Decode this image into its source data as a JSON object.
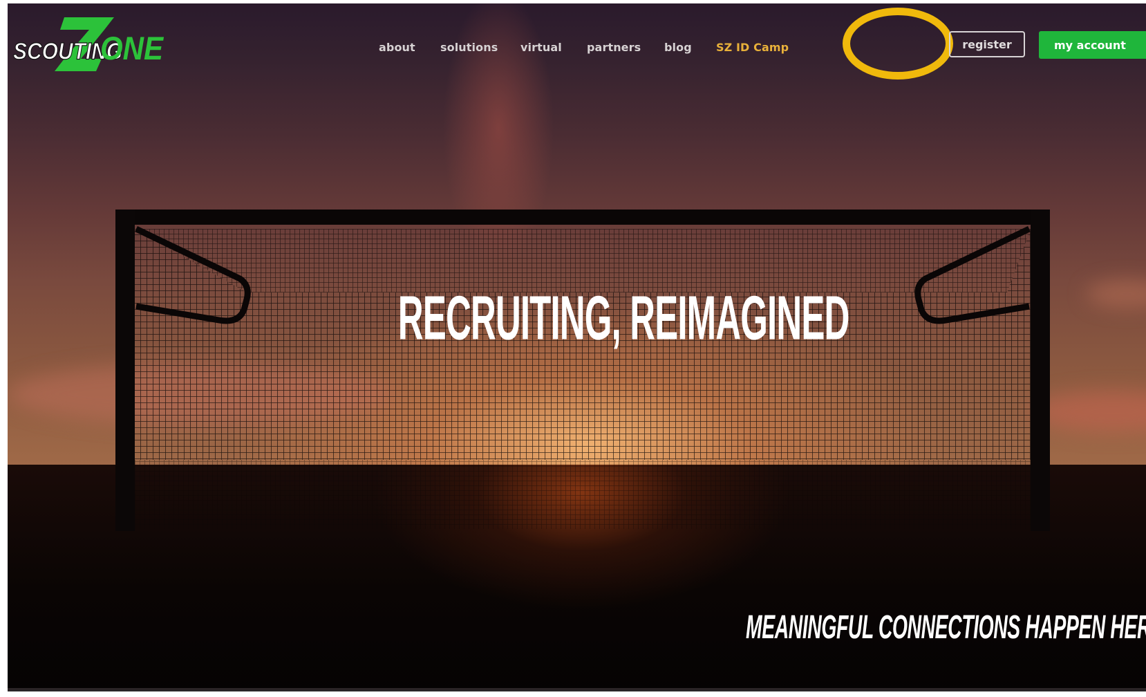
{
  "site": {
    "logo_text_left": "SCOUTING",
    "logo_text_right": "ONE",
    "logo_letter": "Z"
  },
  "nav": {
    "items": [
      {
        "label": "about"
      },
      {
        "label": "solutions"
      },
      {
        "label": "virtual"
      },
      {
        "label": "partners"
      },
      {
        "label": "blog"
      },
      {
        "label": "SZ ID Camp",
        "highlighted": true
      }
    ],
    "register_label": "register",
    "account_label": "my account"
  },
  "hero": {
    "title": "RECRUITING, REIMAGINED",
    "tagline": "MEANINGFUL CONNECTIONS HAPPEN HERE"
  },
  "colors": {
    "brand_green": "#1fb63b",
    "highlight_link": "#e8b13a",
    "annotation_ring": "#f0b90c",
    "nav_text": "#d7d2d3"
  }
}
